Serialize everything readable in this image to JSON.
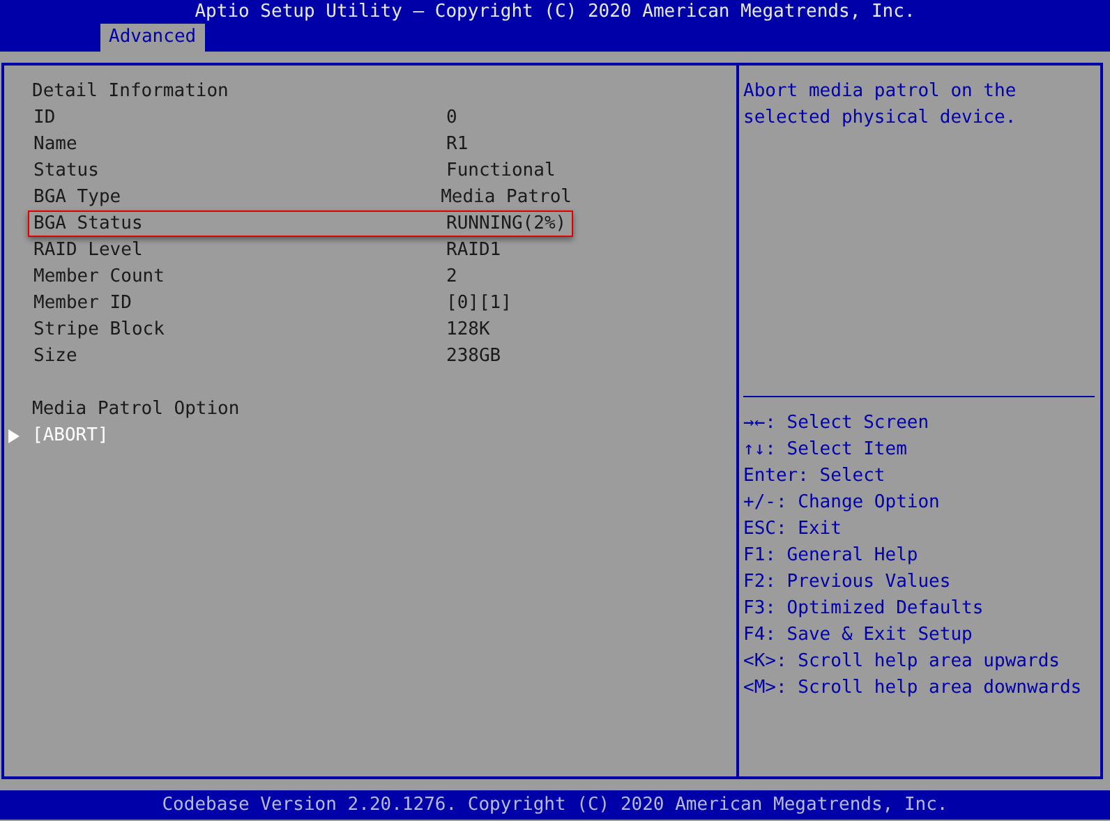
{
  "window": {
    "title": "Aptio Setup Utility – Copyright (C) 2020 American Megatrends, Inc."
  },
  "tabs": [
    {
      "label": "Advanced",
      "selected": true
    }
  ],
  "section_title": "Detail Information",
  "rows": [
    {
      "label": "ID",
      "value": "0",
      "highlighted": false
    },
    {
      "label": "Name",
      "value": "R1",
      "highlighted": false
    },
    {
      "label": "Status",
      "value": "Functional",
      "highlighted": false
    },
    {
      "label": "BGA Type",
      "value": "Media Patrol",
      "highlighted": false
    },
    {
      "label": "BGA Status",
      "value": "RUNNING(2%)",
      "highlighted": true
    },
    {
      "label": "RAID Level",
      "value": "RAID1",
      "highlighted": false
    },
    {
      "label": "Member Count",
      "value": "2",
      "highlighted": false
    },
    {
      "label": "Member ID",
      "value": "[0][1]",
      "highlighted": false
    },
    {
      "label": "Stripe Block",
      "value": "128K",
      "highlighted": false
    },
    {
      "label": "Size",
      "value": "238GB",
      "highlighted": false
    }
  ],
  "option_title": "Media Patrol Option",
  "options": [
    {
      "label": "[ABORT]",
      "selected": true
    }
  ],
  "help_text": "Abort media patrol on the selected physical device.",
  "key_help": [
    "→←: Select Screen",
    "↑↓: Select Item",
    "Enter: Select",
    "+/-: Change Option",
    "ESC: Exit",
    "F1: General Help",
    "F2: Previous Values",
    "F3: Optimized Defaults",
    "F4: Save & Exit Setup",
    "<K>: Scroll help area upwards",
    "<M>: Scroll help area downwards"
  ],
  "status_bar": "Codebase Version 2.20.1276. Copyright (C) 2020 American Megatrends, Inc."
}
